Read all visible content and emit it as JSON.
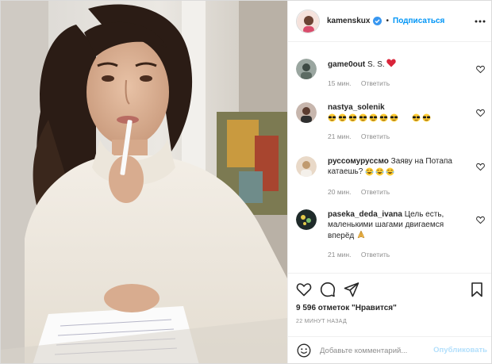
{
  "post": {
    "author": "kamenskux",
    "verified": true,
    "follow_label": "Подписаться",
    "separator": "•"
  },
  "comments": [
    {
      "username": "game0out",
      "text": "S. S.",
      "emoji": [
        "heart"
      ],
      "time": "15 мин.",
      "reply_label": "Ответить"
    },
    {
      "username": "nastya_solenik",
      "text": "",
      "emoji": [
        "sunglasses",
        "sunglasses",
        "sunglasses",
        "sunglasses",
        "sunglasses",
        "sunglasses",
        "sunglasses",
        "sunglasses"
      ],
      "time": "21 мин.",
      "reply_label": "Ответить"
    },
    {
      "username": "руссомуруссмо",
      "text": "Заяву на Потапа катаешь?",
      "emoji": [
        "laughing",
        "laughing",
        "laughing"
      ],
      "time": "20 мин.",
      "reply_label": "Ответить"
    },
    {
      "username": "paseka_deda_ivana",
      "text": "Цель есть, маленькими шагами двигаемся вперёд",
      "emoji": [
        "praying-hands"
      ],
      "time": "21 мин.",
      "reply_label": "Ответить"
    }
  ],
  "stats": {
    "likes_text": "9 596 отметок \"Нравится\"",
    "time_ago": "22 МИНУТ НАЗАД"
  },
  "add_comment": {
    "placeholder": "Добавьте комментарий...",
    "publish_label": "Опубликовать"
  },
  "colors": {
    "accent": "#0095f6",
    "publish_disabled": "#b2dffc",
    "text_secondary": "#8e8e8e",
    "verified": "#3897f0"
  },
  "icons": {
    "header": [
      "verified-icon",
      "more-options-icon"
    ],
    "actions": [
      "heart-icon",
      "comment-icon",
      "share-icon",
      "bookmark-icon"
    ],
    "input": [
      "emoji-icon"
    ]
  }
}
